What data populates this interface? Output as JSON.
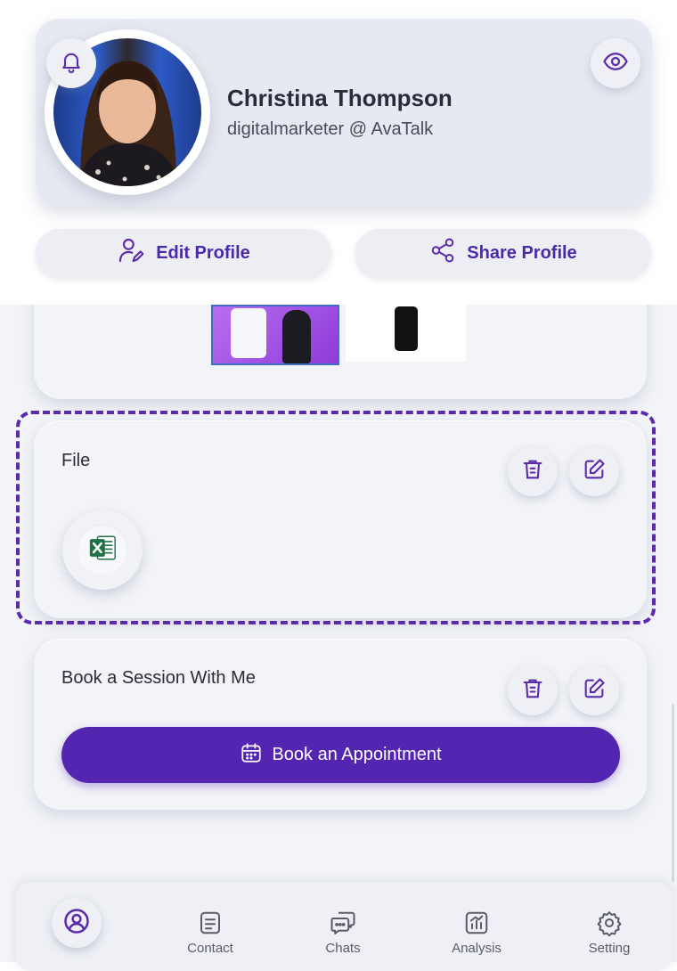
{
  "profile": {
    "name": "Christina Thompson",
    "handle": "digitalmarketer @ AvaTalk"
  },
  "actions": {
    "edit_label": "Edit Profile",
    "share_label": "Share Profile"
  },
  "file_card": {
    "title": "File"
  },
  "booking_card": {
    "title": "Book a Session With Me",
    "button_label": "Book an Appointment"
  },
  "nav": {
    "items": [
      {
        "label": "",
        "icon": "profile-icon"
      },
      {
        "label": "Contact",
        "icon": "contact-icon"
      },
      {
        "label": "Chats",
        "icon": "chats-icon"
      },
      {
        "label": "Analysis",
        "icon": "analysis-icon"
      },
      {
        "label": "Setting",
        "icon": "gear-icon"
      }
    ]
  },
  "colors": {
    "accent": "#5425b1",
    "icon": "#5b2bab",
    "card": "#f3f4f8",
    "excel_green": "#1f7244"
  }
}
